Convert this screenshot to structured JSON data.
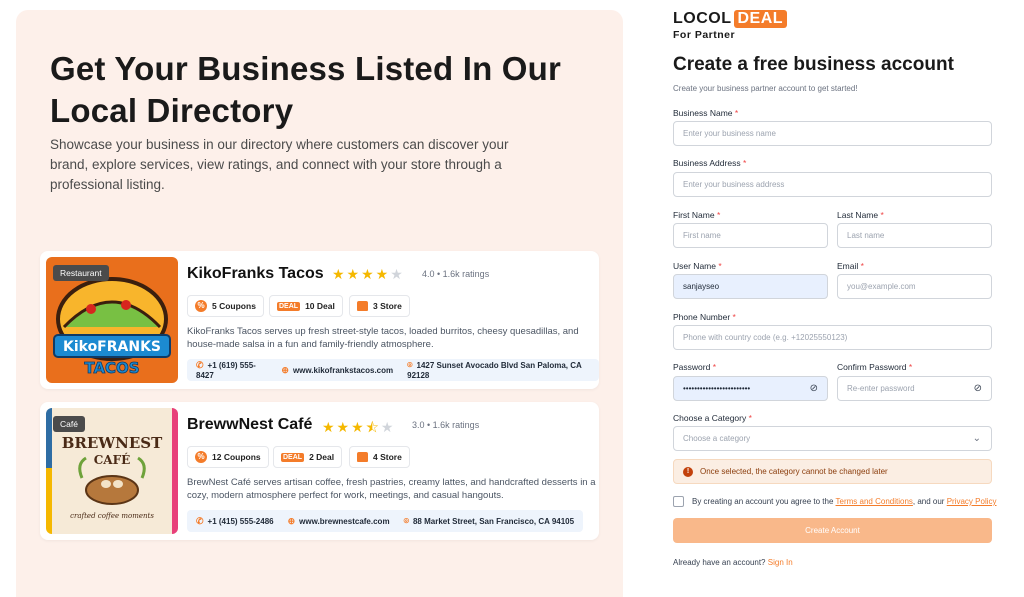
{
  "hero": {
    "title": "Get Your Business Listed In Our Local Directory",
    "subtitle": "Showcase your business in our directory where customers can discover your brand, explore services, view ratings, and connect with your store through a professional listing."
  },
  "listings": [
    {
      "tag": "Restaurant",
      "name": "KikoFranks Tacos",
      "rating": 4.0,
      "rating_text": "4.0 • 1.6k ratings",
      "coupons": "5 Coupons",
      "deals": "10 Deal",
      "stores": "3 Store",
      "description": "KikoFranks Tacos serves up fresh street-style tacos, loaded burritos, cheesy quesadillas, and house-made salsa in a fun and family-friendly atmosphere.",
      "phone": "+1 (619) 555-8427",
      "website": "www.kikofrankstacos.com",
      "address": "1427 Sunset Avocado Blvd San Paloma, CA 92128",
      "logo_line1": "KikoFRANKS",
      "logo_line2": "TACOS"
    },
    {
      "tag": "Café",
      "name": "BrewwNest Café",
      "rating": 3.0,
      "rating_text": "3.0 • 1.6k ratings",
      "coupons": "12 Coupons",
      "deals": "2 Deal",
      "stores": "4 Store",
      "description": "BrewNest Café serves artisan coffee, fresh pastries, creamy lattes, and handcrafted desserts in a cozy, modern atmosphere perfect for work, meetings, and casual hangouts.",
      "phone": "+1 (415) 555-2486",
      "website": "www.brewnestcafe.com",
      "address": "88 Market Street, San Francisco, CA 94105",
      "logo_line1": "BREWNEST",
      "logo_line2": "CAFÉ",
      "logo_line3": "crafted coffee moments"
    }
  ],
  "brand": {
    "local": "LOCOL",
    "deal": "DEAL",
    "sub": "For Partner"
  },
  "form": {
    "title": "Create a free business account",
    "subtitle": "Create your business partner account to get started!",
    "business_name": {
      "label": "Business Name",
      "placeholder": "Enter your business name"
    },
    "business_address": {
      "label": "Business Address",
      "placeholder": "Enter your business address"
    },
    "first_name": {
      "label": "First Name",
      "placeholder": "First name"
    },
    "last_name": {
      "label": "Last Name",
      "placeholder": "Last name"
    },
    "user_name": {
      "label": "User Name",
      "value": "sanjayseo"
    },
    "email": {
      "label": "Email",
      "placeholder": "you@example.com"
    },
    "phone": {
      "label": "Phone Number",
      "placeholder": "Phone with country code (e.g. +12025550123)"
    },
    "password": {
      "label": "Password",
      "value": "••••••••••••••••••••••••"
    },
    "confirm_password": {
      "label": "Confirm Password",
      "placeholder": "Re-enter password"
    },
    "category": {
      "label": "Choose a Category",
      "placeholder": "Choose a category"
    },
    "notice": "Once selected, the category cannot be changed later",
    "agree_prefix": "By creating an account you agree to the",
    "terms": "Terms and Conditions",
    "agree_mid": ", and our",
    "privacy": "Privacy Policy",
    "submit": "Create Account",
    "signin_prompt": "Already have an account?",
    "signin_link": "Sign In",
    "required_mark": "*"
  },
  "colors": {
    "accent": "#f47c2a",
    "panel_bg": "#fdf0ea",
    "button": "#f9b88a"
  }
}
